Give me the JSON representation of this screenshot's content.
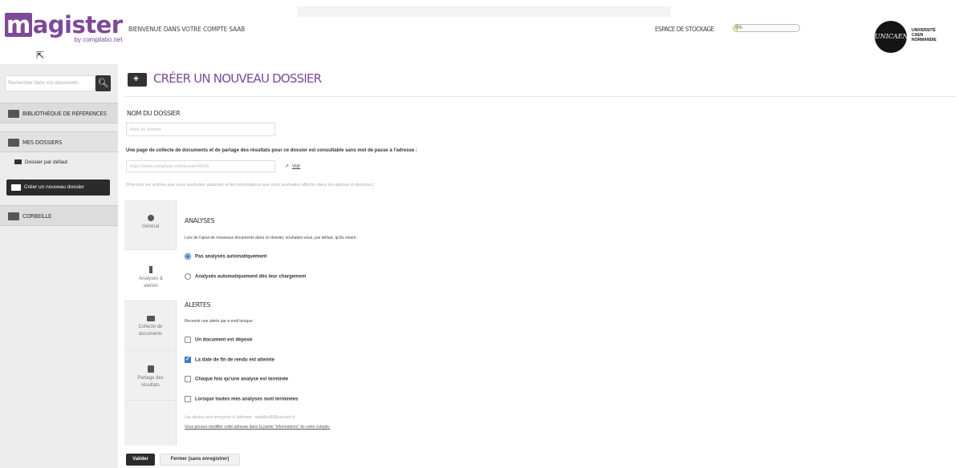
{
  "header": {
    "logo_text": "agister",
    "logo_letter": "m",
    "logo_sub": "by compilatio.net",
    "welcome": "BIENVENUE DANS VOTRE COMPTE SAAB",
    "storage_label": "ESPACE DE STOCKAGE",
    "storage_value": "0%",
    "storage_fraction": 0.06,
    "university_logo_text": "UNICAEN",
    "university_name": "UNIVERSITÉ\nCAEN\nNORMANDIE"
  },
  "sidebar": {
    "search_placeholder": "Rechercher dans vos documents",
    "items": [
      {
        "label": "BIBLIOTHÈQUE DE RÉFÉRENCES"
      },
      {
        "label": "MES DOSSIERS"
      },
      {
        "label": "CORBEILLE"
      }
    ],
    "sub_item": "Dossier par défaut",
    "create_button": "Créer un nouveau dossier"
  },
  "main": {
    "title": "CRÉER UN NOUVEAU DOSSIER",
    "name_label": "NOM DU DOSSIER",
    "name_placeholder": "Nom du dossier",
    "collect_text": "Une page de collecte de documents et de partage des résultats pour ce dossier est consultable sans mot de passe à l'adresse :",
    "url_value": "https://www.compilatio.net/dossier/f4b09",
    "voir_label": "Voir",
    "hint": "[Précisez les actions que vous souhaitez autoriser et les informations que vous souhaitez afficher dans les options ci-dessous.]",
    "tabs": [
      {
        "label": "Général"
      },
      {
        "label": "Analyses & alertes"
      },
      {
        "label": "Collecte de documents"
      },
      {
        "label": "Partage des résultats"
      }
    ],
    "analyses": {
      "heading": "ANALYSES",
      "description": "Lors de l'ajout de nouveaux documents dans ce dossier, souhaitez-vous, par défaut, qu'ils soient :",
      "options": [
        {
          "label": "Pas analysés automatiquement",
          "selected": true
        },
        {
          "label": "Analysés automatiquement dès leur chargement",
          "selected": false
        }
      ]
    },
    "alertes": {
      "heading": "ALERTES",
      "description": "Recevoir une alerte par e-mail lorsque :",
      "checks": [
        {
          "label": "Un document est déposé",
          "checked": false
        },
        {
          "label": "La date de fin de rendu est atteinte",
          "checked": true
        },
        {
          "label": "Chaque fois qu'une analyse est terminée",
          "checked": false
        },
        {
          "label": "Lorsque toutes mes analyses sont terminées",
          "checked": false
        }
      ],
      "email_note": "Les alertes sont envoyées à l'adresse : saabfoo30@unicaen.fr",
      "email_change": "Vous pouvez modifier cette adresse dans la partie \"informations\" de votre compte."
    },
    "buttons": {
      "validate": "Valider",
      "close": "Fermer (sans enregistrer)"
    }
  }
}
